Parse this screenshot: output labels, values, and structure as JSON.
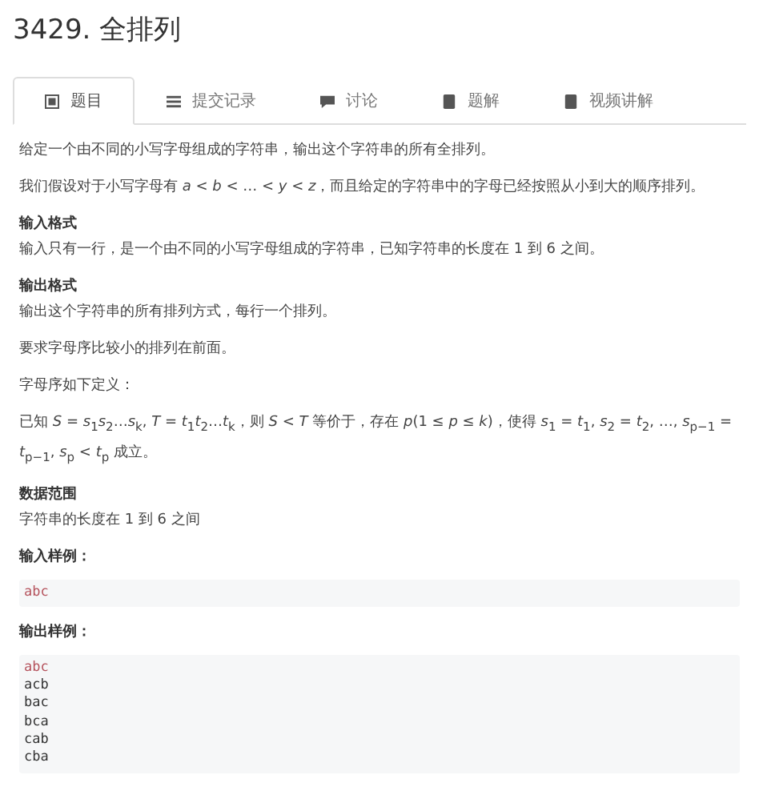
{
  "title": "3429. 全排列",
  "tabs": [
    {
      "label": "题目",
      "kind": "book",
      "selected": true
    },
    {
      "label": "提交记录",
      "kind": "list",
      "selected": false
    },
    {
      "label": "讨论",
      "kind": "chat",
      "selected": false
    },
    {
      "label": "题解",
      "kind": "note",
      "selected": false
    },
    {
      "label": "视频讲解",
      "kind": "note",
      "selected": false
    }
  ],
  "content": [
    {
      "kind": "paragraph",
      "text": "给定一个由不同的小写字母组成的字符串，输出这个字符串的所有全排列。"
    },
    {
      "kind": "paragraph",
      "text": "我们假设对于小写字母有 *a* < *b* < … < *y* < *z*，而且给定的字符串中的字母已经按照从小到大的顺序排列。"
    },
    {
      "kind": "heading",
      "text": "输入格式"
    },
    {
      "kind": "paragraph",
      "text": "输入只有一行，是一个由不同的小写字母组成的字符串，已知字符串的长度在 1 到 6 之间。"
    },
    {
      "kind": "heading",
      "text": "输出格式"
    },
    {
      "kind": "paragraph",
      "text": "输出这个字符串的所有排列方式，每行一个排列。"
    },
    {
      "kind": "paragraph",
      "text": "要求字母序比较小的排列在前面。"
    },
    {
      "kind": "paragraph",
      "text": "字母序如下定义："
    },
    {
      "kind": "paragraph",
      "text": "已知 *S* = *s*$_{1}$*s*$_{2}$…*s*$_{k}$, *T* = *t*$_{1}$*t*$_{2}$…*t*$_{k}$，则 *S* < *T* 等价于，存在 *p*(1 ≤ *p* ≤ *k*)，使得 *s*$_{1}$ = *t*$_{1}$, *s*$_{2}$ = *t*$_{2}$, …, *s*$_{p−1}$ = *t*$_{p−1}$, *s*$_{p}$ < *t*$_{p}$ 成立。"
    },
    {
      "kind": "heading",
      "text": "数据范围"
    },
    {
      "kind": "paragraph",
      "text": "字符串的长度在 1 到 6 之间"
    },
    {
      "kind": "sample_heading",
      "text": "输入样例："
    },
    {
      "kind": "code",
      "lines": [
        {
          "text": "abc",
          "color": "#b5525c"
        }
      ]
    },
    {
      "kind": "sample_heading",
      "text": "输出样例："
    },
    {
      "kind": "code",
      "lines": [
        {
          "text": "abc",
          "color": "#b5525c"
        },
        {
          "text": "acb",
          "color": "#333333"
        },
        {
          "text": "bac",
          "color": "#333333"
        },
        {
          "text": "bca",
          "color": "#333333"
        },
        {
          "text": "cab",
          "color": "#333333"
        },
        {
          "text": "cba",
          "color": "#333333"
        }
      ]
    }
  ]
}
